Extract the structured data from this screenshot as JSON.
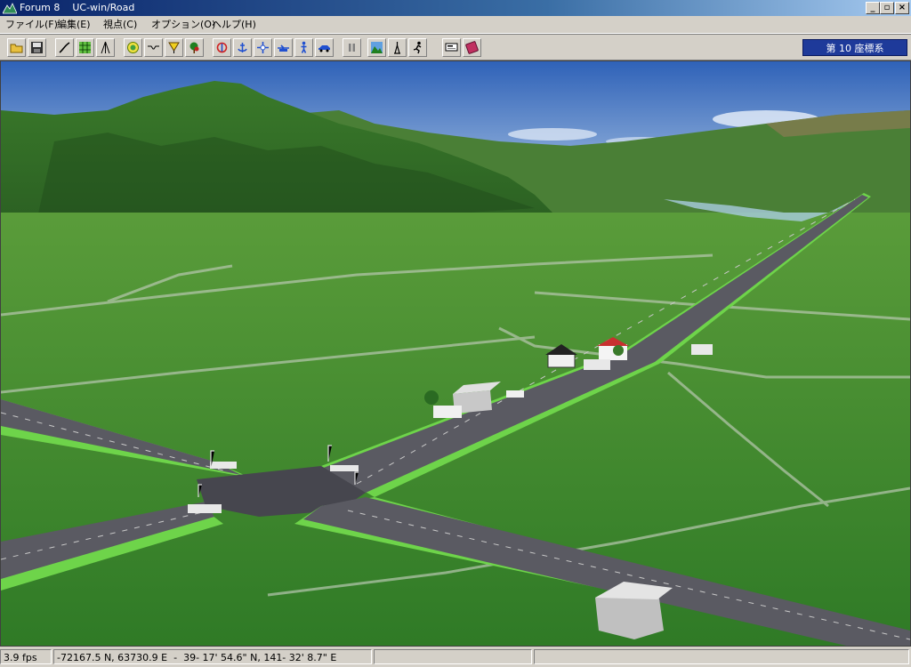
{
  "window": {
    "title": "Forum 8    UC-win/Road"
  },
  "menu": [
    {
      "name": "menu-file",
      "label": "ファイル(F)"
    },
    {
      "name": "menu-edit",
      "label": "編集(E)"
    },
    {
      "name": "menu-view",
      "label": "視点(C)"
    },
    {
      "name": "menu-options",
      "label": "オプション(O)"
    },
    {
      "name": "menu-help",
      "label": "ヘルプ(H)"
    }
  ],
  "toolbar": {
    "coordinate_system": "第 10 座標系",
    "icons": [
      "open-folder-icon",
      "save-icon",
      "road-edit-icon",
      "grid-icon",
      "compass-icon",
      "terrain-icon",
      "cross-section-icon",
      "sign-icon",
      "tree-icon",
      "rotate-icon",
      "anchor-icon",
      "move-icon",
      "fly-icon",
      "walk-person-icon",
      "car-icon",
      "pause-icon",
      "landscape-icon",
      "tower-icon",
      "run-icon",
      "display-icon",
      "book-icon"
    ]
  },
  "status": {
    "fps": "3.9 fps",
    "coordinates": "-72167.5 N, 63730.9 E  -  39- 17' 54.6\" N, 141- 32' 8.7\" E"
  },
  "colors": {
    "sky_top": "#3a6fc2",
    "sky_bottom": "#b4cde8",
    "grass": "#3f8a2e",
    "road": "#5a5a62",
    "road_shoulder": "#6ed44a",
    "coord_badge": "#1e3a9a"
  }
}
